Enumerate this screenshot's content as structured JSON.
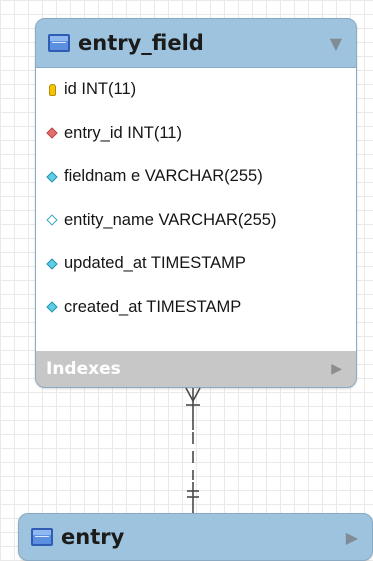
{
  "tables": [
    {
      "name": "entry_field",
      "collapse_glyph": "▼",
      "icon": "table-icon",
      "columns": [
        {
          "text": "id INT(11)",
          "icon": "primary-key-icon"
        },
        {
          "text": "entry_id INT(11)",
          "icon": "foreign-key-icon"
        },
        {
          "text": "fieldnam e VARCHAR(255)",
          "icon": "not-null-column-icon"
        },
        {
          "text": "entity_name VARCHAR(255)",
          "icon": "nullable-column-icon"
        },
        {
          "text": "updated_at TIMESTAMP",
          "icon": "not-null-column-icon"
        },
        {
          "text": "created_at TIMESTAMP",
          "icon": "not-null-column-icon"
        }
      ],
      "indexes_label": "Indexes",
      "indexes_glyph": "▶"
    },
    {
      "name": "entry",
      "collapse_glyph": "▶",
      "icon": "table-icon"
    }
  ],
  "relationship": {
    "from": "entry_field",
    "to": "entry",
    "from_end": "many",
    "to_end": "one-and-only-one",
    "line_style": "dashed"
  },
  "colors": {
    "card": "#9ec3de",
    "indexes_bar": "#c7c7c7",
    "foreign_key": "#e36f6f",
    "column_marker": "#5ccfe6",
    "table_icon": "#2f5db3"
  }
}
